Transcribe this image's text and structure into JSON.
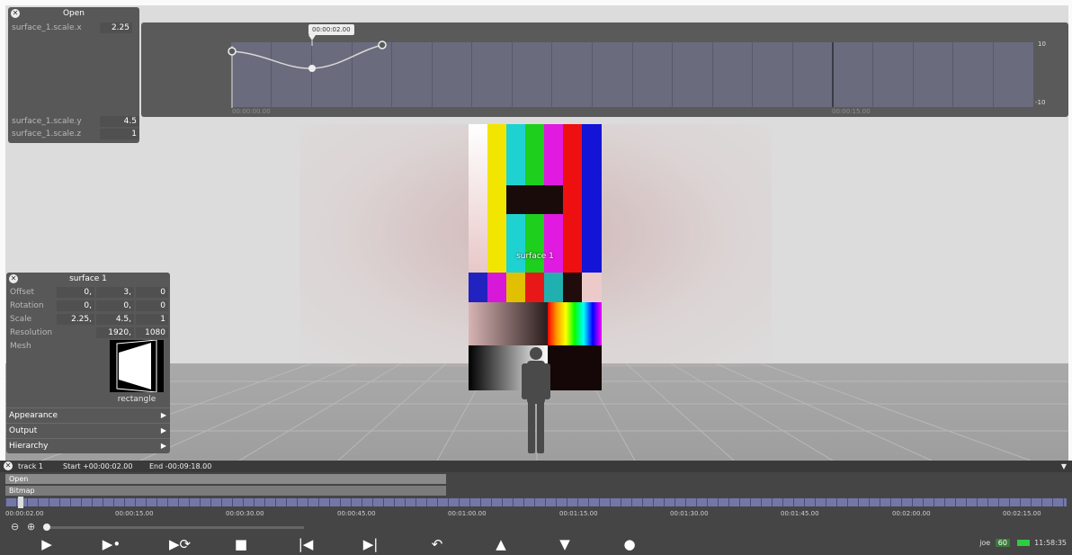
{
  "colors": {
    "panel_bg": "#585858",
    "curve_bg": "#6a6b7d",
    "ruler": "#7377a8",
    "battery": "#2ecc40",
    "fps_bg": "#3a7a3a"
  },
  "open_panel": {
    "title": "Open",
    "rows": [
      {
        "label": "surface_1.scale.x",
        "value": "2.25"
      },
      {
        "label": "surface_1.scale.y",
        "value": "4.5"
      },
      {
        "label": "surface_1.scale.z",
        "value": "1"
      }
    ]
  },
  "curve_editor": {
    "playhead_time": "00:00:02.00",
    "start_time": "00:00:00.00",
    "mid_time": "00:00:15.00",
    "max_label": "10",
    "min_label": "-10"
  },
  "surface_panel": {
    "title": "surface 1",
    "offset": {
      "label": "Offset",
      "values": [
        "0,",
        "3,",
        "0"
      ]
    },
    "rotation": {
      "label": "Rotation",
      "values": [
        "0,",
        "0,",
        "0"
      ]
    },
    "scale": {
      "label": "Scale",
      "values": [
        "2.25,",
        "4.5,",
        "1"
      ]
    },
    "resolution": {
      "label": "Resolution",
      "values": [
        "1920,",
        "1080"
      ]
    },
    "mesh": {
      "label": "Mesh",
      "name": "rectangle"
    },
    "sections": [
      "Appearance",
      "Output",
      "Hierarchy"
    ]
  },
  "scene": {
    "surface_label": "surface 1",
    "test_box_text": "-- --\n-- --"
  },
  "track": {
    "name": "track 1",
    "start": "Start +00:00:02.00",
    "end": "End -00:09:18.00",
    "clips": [
      "Open",
      "Bitmap"
    ],
    "ruler_times": [
      "00:00:02.00",
      "00:00:15.00",
      "00:00:30.00",
      "00:00:45.00",
      "00:01:00.00",
      "00:01:15.00",
      "00:01:30.00",
      "00:01:45.00",
      "00:02:00.00",
      "00:02:15.00"
    ]
  },
  "transport": {
    "buttons": [
      {
        "name": "play-button",
        "glyph": "▶"
      },
      {
        "name": "play-slow-button",
        "glyph": "▶•"
      },
      {
        "name": "loop-button",
        "glyph": "▶⟳"
      },
      {
        "name": "stop-button",
        "glyph": "■"
      },
      {
        "name": "skip-start-button",
        "glyph": "|◀"
      },
      {
        "name": "skip-end-button",
        "glyph": "▶|"
      },
      {
        "name": "undo-button",
        "glyph": "↶"
      },
      {
        "name": "up-button",
        "glyph": "▲"
      },
      {
        "name": "down-button",
        "glyph": "▼"
      },
      {
        "name": "record-button",
        "glyph": "●"
      }
    ]
  },
  "status": {
    "user": "joe",
    "fps": "60",
    "clock": "11:58:35"
  }
}
